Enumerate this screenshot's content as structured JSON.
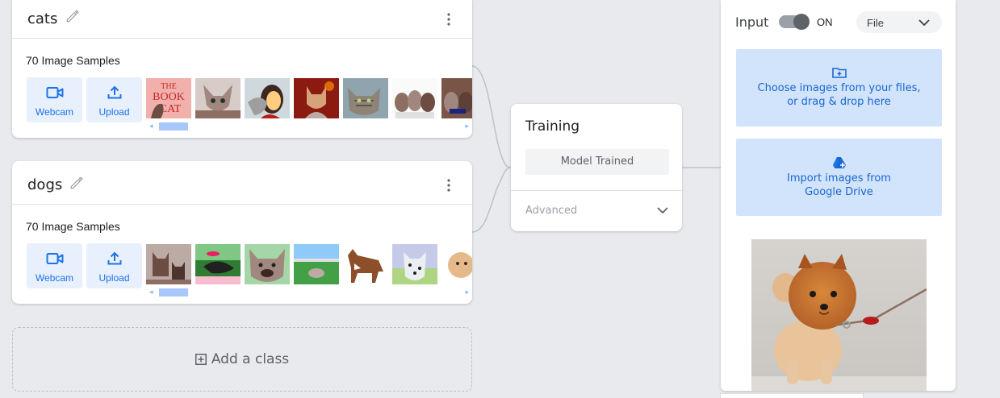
{
  "classes": [
    {
      "name": "cats",
      "sample_count": "70 Image Samples",
      "webcam_label": "Webcam",
      "upload_label": "Upload",
      "thumbnails": [
        "book-cat-cover",
        "sphynx-cat",
        "woman-with-cat",
        "cat-on-red-background",
        "tabby-cat",
        "kittens-group",
        "cats-partial"
      ]
    },
    {
      "name": "dogs",
      "sample_count": "70 Image Samples",
      "webcam_label": "Webcam",
      "upload_label": "Upload",
      "thumbnails": [
        "german-shepherds",
        "dog-catching-frisbee",
        "dog-closeup",
        "dog-on-field",
        "brown-dog-standing",
        "dalmatian-puppy",
        "small-fluffy-dog-partial"
      ]
    }
  ],
  "add_class_label": "Add a class",
  "training": {
    "title": "Training",
    "button_label": "Model Trained",
    "advanced_label": "Advanced"
  },
  "preview": {
    "input_label": "Input",
    "toggle_state": "ON",
    "source_select": "File",
    "choose_files_line1": "Choose images from your files,",
    "choose_files_line2": "or drag & drop here",
    "drive_line1": "Import images from",
    "drive_line2": "Google Drive",
    "image_subject": "pomeranian-on-leash"
  },
  "colors": {
    "accent": "#1a73e8",
    "tile_bg": "#e8f0fe",
    "drop_bg": "#d2e3fc",
    "page_bg": "#e8eaed"
  }
}
